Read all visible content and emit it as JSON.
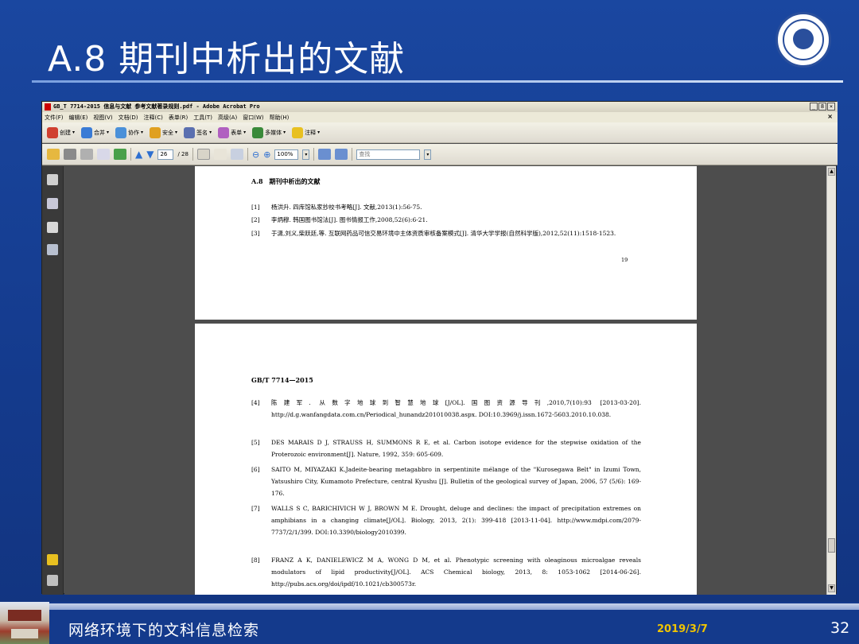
{
  "slide": {
    "title": "A.8 期刊中析出的文献",
    "footer_text": "网络环境下的文科信息检索",
    "date": "2019/3/7",
    "page_number": "32"
  },
  "window": {
    "title": "GB_T 7714-2015 信息与文献 参考文献著录规则.pdf - Adobe Acrobat Pro",
    "buttons": [
      "_",
      "8",
      "×"
    ],
    "close_doc": "×"
  },
  "menu": [
    "文件(F)",
    "编辑(E)",
    "视图(V)",
    "文档(D)",
    "注释(C)",
    "表单(R)",
    "工具(T)",
    "高级(A)",
    "窗口(W)",
    "帮助(H)"
  ],
  "toolbar1": [
    {
      "label": "创建",
      "icon": "create-pdf-icon",
      "color": "#d04030"
    },
    {
      "label": "合并",
      "icon": "combine-icon",
      "color": "#3a7bd5"
    },
    {
      "label": "协作",
      "icon": "collaborate-icon",
      "color": "#4a90d9"
    },
    {
      "label": "安全",
      "icon": "lock-icon",
      "color": "#e0a020"
    },
    {
      "label": "签名",
      "icon": "pen-icon",
      "color": "#5a6fb0"
    },
    {
      "label": "表单",
      "icon": "form-icon",
      "color": "#b060c0"
    },
    {
      "label": "多媒体",
      "icon": "multimedia-icon",
      "color": "#3a8a3a"
    },
    {
      "label": "注释",
      "icon": "comment-icon",
      "color": "#e8c020"
    }
  ],
  "toolbar2": {
    "current_page": "26",
    "total_pages": "/ 28",
    "zoom": "100%",
    "search_placeholder": "查找"
  },
  "page1": {
    "heading": "A.8　期刊中析出的文献",
    "refs": [
      {
        "num": "[1]",
        "text": "杨洪升. 四库馆私家抄校书考略[J]. 文献,2013(1):56-75."
      },
      {
        "num": "[2]",
        "text": "李炳穆. 韩国图书馆法[J]. 图书情报工作,2008,52(6):6-21."
      },
      {
        "num": "[3]",
        "text": "于潇,刘义,柴跃廷,等. 互联网药品可信交易环境中主体资质审核备案模式[J]. 清华大学学报(自然科学版),2012,52(11):1518-1523."
      }
    ],
    "page_num": "19"
  },
  "page2": {
    "heading": "GB/T 7714—2015",
    "refs": [
      {
        "num": "[4]",
        "text": "陈建军. 从数字地球到智慧地球[J/OL].国图资源导刊,2010,7(10):93 [2013-03-20]. http://d.g.wanfangdata.com.cn/Periodical_hunandz201010038.aspx. DOI:10.3969/j.issn.1672-5603.2010.10.038."
      },
      {
        "num": "[5]",
        "text": "DES MARAIS D J, STRAUSS H, SUMMONS R E, et al. Carbon isotope evidence for the stepwise oxidation of the Proterozoic environment[J]. Nature, 1992, 359: 605-609."
      },
      {
        "num": "[6]",
        "text": "SAITO M, MIYAZAKI K.Jadeite-bearing metagabbro in serpentinite mélange of the \"Kurosegawa Belt\" in Izumi Town, Yatsushiro City, Kumamoto Prefecture, central Kyushu [J]. Bulletin of the geological survey of Japan, 2006, 57 (5/6): 169-176."
      },
      {
        "num": "[7]",
        "text": "WALLS S C, BARICHIVICH W J, BROWN M E. Drought, deluge and declines: the impact of precipitation extremes on amphibians in a changing climate[J/OL]. Biology, 2013, 2(1): 399-418 [2013-11-04]. http://www.mdpi.com/2079-7737/2/1/399. DOI:10.3390/biology2010399."
      },
      {
        "num": "[8]",
        "text": "FRANZ A K, DANIELEWICZ M A, WONG D M, et al. Phenotypic screening with oleaginous microalgae reveals modulators of lipid productivity[J/OL]. ACS Chemical biology, 2013, 8: 1053-1062 [2014-06-26]. http://pubs.acs.org/doi/ipdf/10.1021/cb300573r."
      }
    ]
  },
  "colors": {
    "slide_bg": "#143a8c",
    "date": "#f0c400",
    "doc_bg": "#4d4d4d"
  }
}
